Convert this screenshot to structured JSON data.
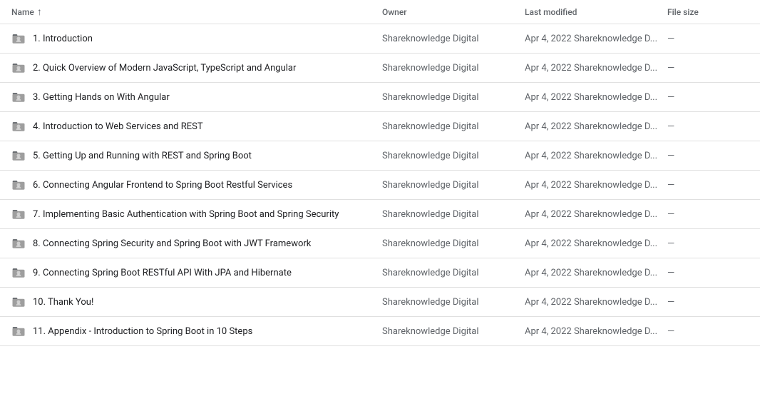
{
  "header": {
    "name_label": "Name",
    "sort_icon": "↑",
    "owner_label": "Owner",
    "modified_label": "Last modified",
    "size_label": "File size"
  },
  "rows": [
    {
      "id": 1,
      "name": "1. Introduction",
      "owner": "Shareknowledge Digital",
      "modified": "Apr 4, 2022 Shareknowledge D...",
      "size": "—"
    },
    {
      "id": 2,
      "name": "2. Quick Overview of Modern JavaScript, TypeScript and Angular",
      "owner": "Shareknowledge Digital",
      "modified": "Apr 4, 2022 Shareknowledge D...",
      "size": "—"
    },
    {
      "id": 3,
      "name": "3. Getting Hands on With Angular",
      "owner": "Shareknowledge Digital",
      "modified": "Apr 4, 2022 Shareknowledge D...",
      "size": "—"
    },
    {
      "id": 4,
      "name": "4. Introduction to Web Services and REST",
      "owner": "Shareknowledge Digital",
      "modified": "Apr 4, 2022 Shareknowledge D...",
      "size": "—"
    },
    {
      "id": 5,
      "name": "5. Getting Up and Running with REST and Spring Boot",
      "owner": "Shareknowledge Digital",
      "modified": "Apr 4, 2022 Shareknowledge D...",
      "size": "—"
    },
    {
      "id": 6,
      "name": "6. Connecting Angular Frontend to Spring Boot Restful Services",
      "owner": "Shareknowledge Digital",
      "modified": "Apr 4, 2022 Shareknowledge D...",
      "size": "—"
    },
    {
      "id": 7,
      "name": "7. Implementing Basic Authentication with Spring Boot and Spring Security",
      "owner": "Shareknowledge Digital",
      "modified": "Apr 4, 2022 Shareknowledge D...",
      "size": "—"
    },
    {
      "id": 8,
      "name": "8. Connecting Spring Security and Spring Boot with JWT Framework",
      "owner": "Shareknowledge Digital",
      "modified": "Apr 4, 2022 Shareknowledge D...",
      "size": "—"
    },
    {
      "id": 9,
      "name": "9. Connecting Spring Boot RESTful API With JPA and Hibernate",
      "owner": "Shareknowledge Digital",
      "modified": "Apr 4, 2022 Shareknowledge D...",
      "size": "—"
    },
    {
      "id": 10,
      "name": "10. Thank You!",
      "owner": "Shareknowledge Digital",
      "modified": "Apr 4, 2022 Shareknowledge D...",
      "size": "—"
    },
    {
      "id": 11,
      "name": "11. Appendix - Introduction to Spring Boot in 10 Steps",
      "owner": "Shareknowledge Digital",
      "modified": "Apr 4, 2022 Shareknowledge D...",
      "size": "—"
    }
  ]
}
